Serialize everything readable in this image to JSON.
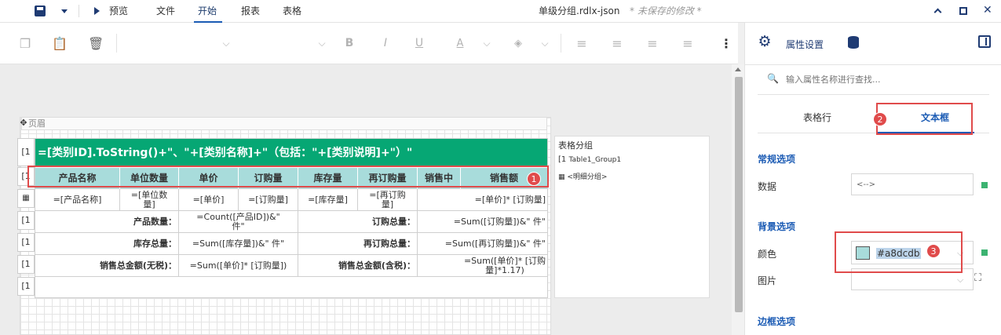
{
  "menubar": {
    "preview_label": "预览",
    "menus": [
      "文件",
      "开始",
      "报表",
      "表格"
    ],
    "active_menu": "开始",
    "doc_title": "单级分组.rdlx-json",
    "unsaved": "* 未保存的修改 *"
  },
  "right_header": {
    "properties_tab": "属性设置"
  },
  "report": {
    "page_header_label": "页眉",
    "title_expression": "=[类别ID].ToString()+\"、\"+[类别名称]+\"（包括：\"+[类别说明]+\"）\"",
    "row_handles": [
      "[1",
      "[1",
      "[1",
      "[1",
      "[1",
      "[1"
    ],
    "header_cells": [
      "产品名称",
      "单位数量",
      "单价",
      "订购量",
      "库存量",
      "再订购量",
      "销售中",
      "销售额"
    ],
    "detail_cells": [
      "=[产品名称]",
      "=[单位数\n量]",
      "=[单价]",
      "=[订购量]",
      "=[库存量]",
      "=[再订购\n量]",
      "=[单价]* [订购量]"
    ],
    "footer_rows": [
      [
        "产品数量：",
        "=Count([产品ID])&\"\n件\"",
        "订购总量：",
        "=Sum([订购量])&\" 件\""
      ],
      [
        "库存总量：",
        "=Sum([库存量])&\" 件\"",
        "再订购总量：",
        "=Sum([再订购量])&\" 件\""
      ],
      [
        "销售总金额(无税)：",
        "=Sum([单价]* [订购量])",
        "销售总金额(含税)：",
        "=Sum([单价]* [订购\n量]*1.17)"
      ]
    ]
  },
  "group_panel": {
    "title": "表格分组",
    "items": [
      "Table1_Group1",
      "<明细分组>"
    ],
    "item_prefix": "[1"
  },
  "properties": {
    "search_placeholder": "输入属性名称进行查找...",
    "tabs": [
      "表格行",
      "文本框"
    ],
    "active_tab": "文本框",
    "general_section": "常规选项",
    "data_label": "数据",
    "data_value": "<-->",
    "background_section": "背景选项",
    "color_label": "颜色",
    "color_value": "#a8dcdb",
    "image_label": "图片",
    "border_section": "边框选项"
  },
  "badges": [
    "1",
    "2",
    "3"
  ],
  "colors": {
    "title_band": "#06a774",
    "header_fill": "#a8dcdb",
    "accent": "#1b5bb4",
    "annotation": "#e04b4b"
  }
}
